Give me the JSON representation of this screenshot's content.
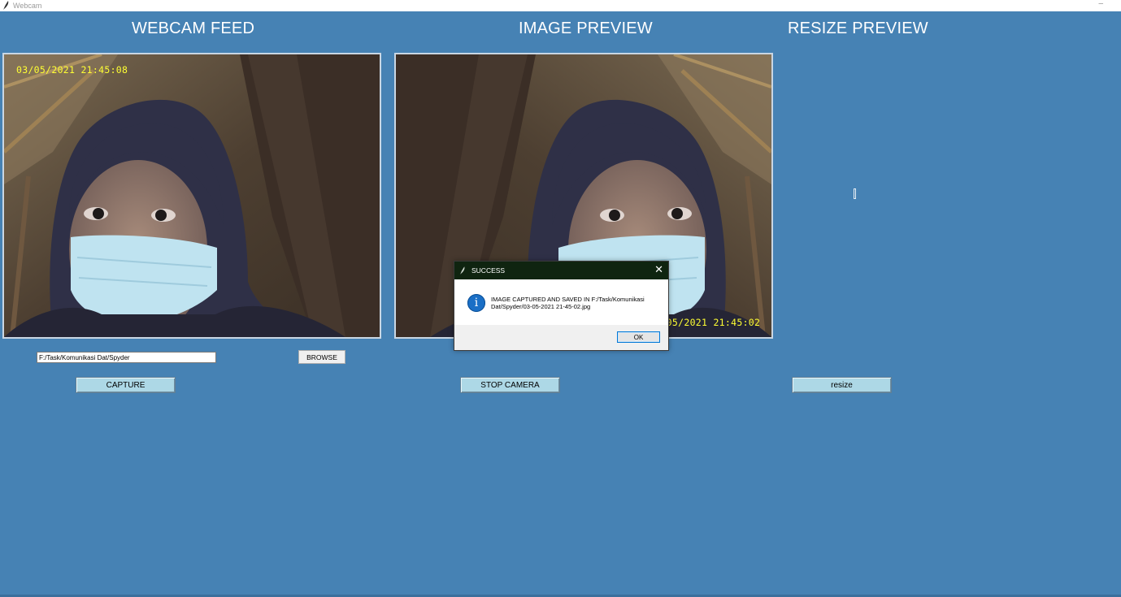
{
  "window": {
    "title": "Webcam",
    "minimize_glyph": "–",
    "icon": "feather-icon"
  },
  "headings": {
    "webcam_feed": "WEBCAM FEED",
    "image_preview": "IMAGE PREVIEW",
    "resize_preview": "RESIZE PREVIEW"
  },
  "webcam": {
    "timestamp": "03/05/2021 21:45:08"
  },
  "preview": {
    "timestamp": "03/05/2021 21:45:02"
  },
  "controls": {
    "path_value": "F:/Task/Komunikasi Dat/Spyder",
    "browse_label": "BROWSE",
    "capture_label": "CAPTURE",
    "stop_camera_label": "STOP CAMERA",
    "resize_label": "resize"
  },
  "dialog": {
    "title": "SUCCESS",
    "close_glyph": "✕",
    "icon": "info-icon",
    "icon_glyph": "i",
    "message": "IMAGE CAPTURED AND SAVED IN F:/Task/Komunikasi Dat/Spyder/03-05-2021 21-45-02.jpg",
    "ok_label": "OK"
  },
  "colors": {
    "background": "#4682b4",
    "button": "#add8e6",
    "timestamp": "#ffff33",
    "dialog_titlebar": "#0f2410",
    "info_icon": "#1a6fc6"
  }
}
